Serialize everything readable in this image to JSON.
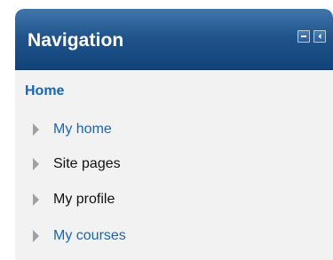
{
  "block": {
    "title": "Navigation",
    "controls": [
      {
        "icon": "minimize-icon"
      },
      {
        "icon": "dock-icon"
      }
    ]
  },
  "home": {
    "label": "Home"
  },
  "items": [
    {
      "label": "My home",
      "is_link": true
    },
    {
      "label": "Site pages",
      "is_link": false
    },
    {
      "label": "My profile",
      "is_link": false
    },
    {
      "label": "My courses",
      "is_link": true
    }
  ],
  "colors": {
    "header_top": "#3f77ad",
    "header_bottom": "#0f4379",
    "link": "#1a66b0",
    "content_bg": "#f2f2f2",
    "arrow": "#a0a0a0"
  }
}
